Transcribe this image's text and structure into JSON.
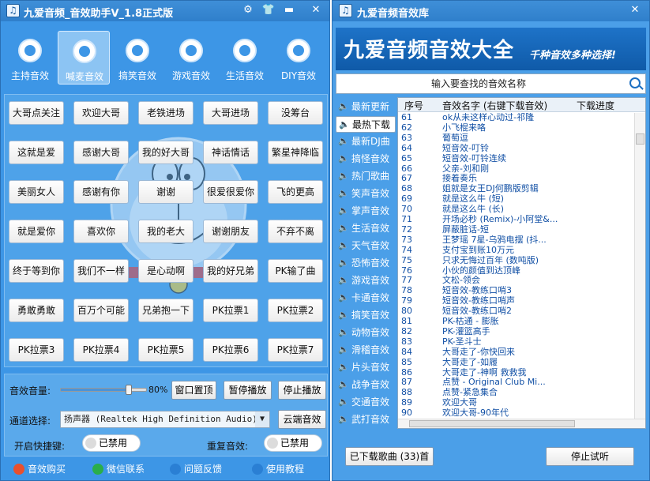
{
  "left": {
    "title": "九爱音频_音效助手V_1.8正式版",
    "title_icon": "music-note-icon",
    "categories": [
      {
        "label": "主持音效",
        "icon": "person-icon"
      },
      {
        "label": "喊麦音效",
        "icon": "disc-icon",
        "active": true
      },
      {
        "label": "搞笑音效",
        "icon": "gamepad-icon"
      },
      {
        "label": "游戏音效",
        "icon": "controller-icon"
      },
      {
        "label": "生活音效",
        "icon": "bell-icon"
      },
      {
        "label": "DIY音效",
        "icon": "bell-icon"
      }
    ],
    "sound_buttons": [
      [
        "大哥点关注",
        "欢迎大哥",
        "老铁进场",
        "大哥进场",
        "没筹台"
      ],
      [
        "这就是爱",
        "感谢大哥",
        "我的好大哥",
        "神话情话",
        "繁星神降临"
      ],
      [
        "美丽女人",
        "感谢有你",
        "谢谢",
        "很爱很爱你",
        "飞的更高"
      ],
      [
        "就是爱你",
        "喜欢你",
        "我的老大",
        "谢谢朋友",
        "不弃不离"
      ],
      [
        "终于等到你",
        "我们不一样",
        "是心动啊",
        "我的好兄弟",
        "PK输了曲"
      ],
      [
        "勇敢勇敢",
        "百万个可能",
        "兄弟抱一下",
        "PK拉票1",
        "PK拉票2"
      ],
      [
        "PK拉票3",
        "PK拉票4",
        "PK拉票5",
        "PK拉票6",
        "PK拉票7"
      ]
    ],
    "volume_label": "音效音量:",
    "volume_percent": 80,
    "volume_text": "80%",
    "btn_window_top": "窗口置顶",
    "btn_pause": "暂停播放",
    "btn_stop": "停止播放",
    "channel_label": "通道选择:",
    "channel_value": "扬声器 (Realtek High Definition Audio)",
    "btn_cloud": "云端音效",
    "hotkey_label": "开启快捷键:",
    "hotkey_state": "已禁用",
    "repeat_label": "重复音效:",
    "repeat_state": "已禁用",
    "footer": [
      {
        "label": "音效购买",
        "icon": "cart-icon",
        "color": "#e8502e"
      },
      {
        "label": "微信联系",
        "icon": "wechat-icon",
        "color": "#2aae4a"
      },
      {
        "label": "问题反馈",
        "icon": "question-icon",
        "color": "#2a7fd4"
      },
      {
        "label": "使用教程",
        "icon": "user-icon",
        "color": "#2a7fd4"
      }
    ]
  },
  "right": {
    "title": "九爱音频音效库",
    "banner_title": "九爱音频音效大全",
    "banner_slogan": "千种音效多种选择!",
    "search_placeholder": "输入要查找的音效名称",
    "categories": [
      "最新更新",
      "最热下载",
      "最新DJ曲",
      "搞怪音效",
      "热门歌曲",
      "笑声音效",
      "掌声音效",
      "生活音效",
      "天气音效",
      "恐怖音效",
      "游戏音效",
      "卡通音效",
      "搞笑音效",
      "动物音效",
      "滑稽音效",
      "片头音效",
      "战争音效",
      "交通音效",
      "武打音效"
    ],
    "active_category": 1,
    "columns": {
      "no": "序号",
      "name": "音效名字 (右键下载音效)",
      "progress": "下载进度"
    },
    "rows": [
      [
        "61",
        "ok从未这样心动过-祁隆"
      ],
      [
        "62",
        "小飞棍来咯"
      ],
      [
        "63",
        "葡萄逗"
      ],
      [
        "64",
        "短音效-叮铃"
      ],
      [
        "65",
        "短音效-叮铃连续"
      ],
      [
        "66",
        "父亲-刘和刚"
      ],
      [
        "67",
        "接着奏乐"
      ],
      [
        "68",
        "姐就是女王DJ何鹏版剪辑"
      ],
      [
        "69",
        "就是这么牛 (短)"
      ],
      [
        "70",
        "就是这么牛 (长)"
      ],
      [
        "71",
        "开场必秒 (Remix)-小阿堂&..."
      ],
      [
        "72",
        "屏蔽脏话-短"
      ],
      [
        "73",
        "王梦瑶 7星-乌鸦电摆 (抖..."
      ],
      [
        "74",
        "支付宝到账10万元"
      ],
      [
        "75",
        "只求无悔过百年 (数吨版)"
      ],
      [
        "76",
        "小伙的颜值到达顶峰"
      ],
      [
        "77",
        "文松-领会"
      ],
      [
        "78",
        "短音效-教练口哨3"
      ],
      [
        "79",
        "短音效-教练口哨声"
      ],
      [
        "80",
        "短音效-教练口哨2"
      ],
      [
        "81",
        "PK-枯通 - 膨胀"
      ],
      [
        "82",
        "PK-灌篮高手"
      ],
      [
        "83",
        "PK-圣斗士"
      ],
      [
        "84",
        "大哥走了-你快回来"
      ],
      [
        "85",
        "大哥走了-如履"
      ],
      [
        "86",
        "大哥走了-神啊 救救我"
      ],
      [
        "87",
        "点赞 - Original Club Mi..."
      ],
      [
        "88",
        "点赞-紧急集合"
      ],
      [
        "89",
        "欢迎大哥"
      ],
      [
        "90",
        "欢迎大哥-90年代"
      ]
    ],
    "downloaded_label": "已下载歌曲 (33)首",
    "btn_stop_preview": "停止试听"
  }
}
